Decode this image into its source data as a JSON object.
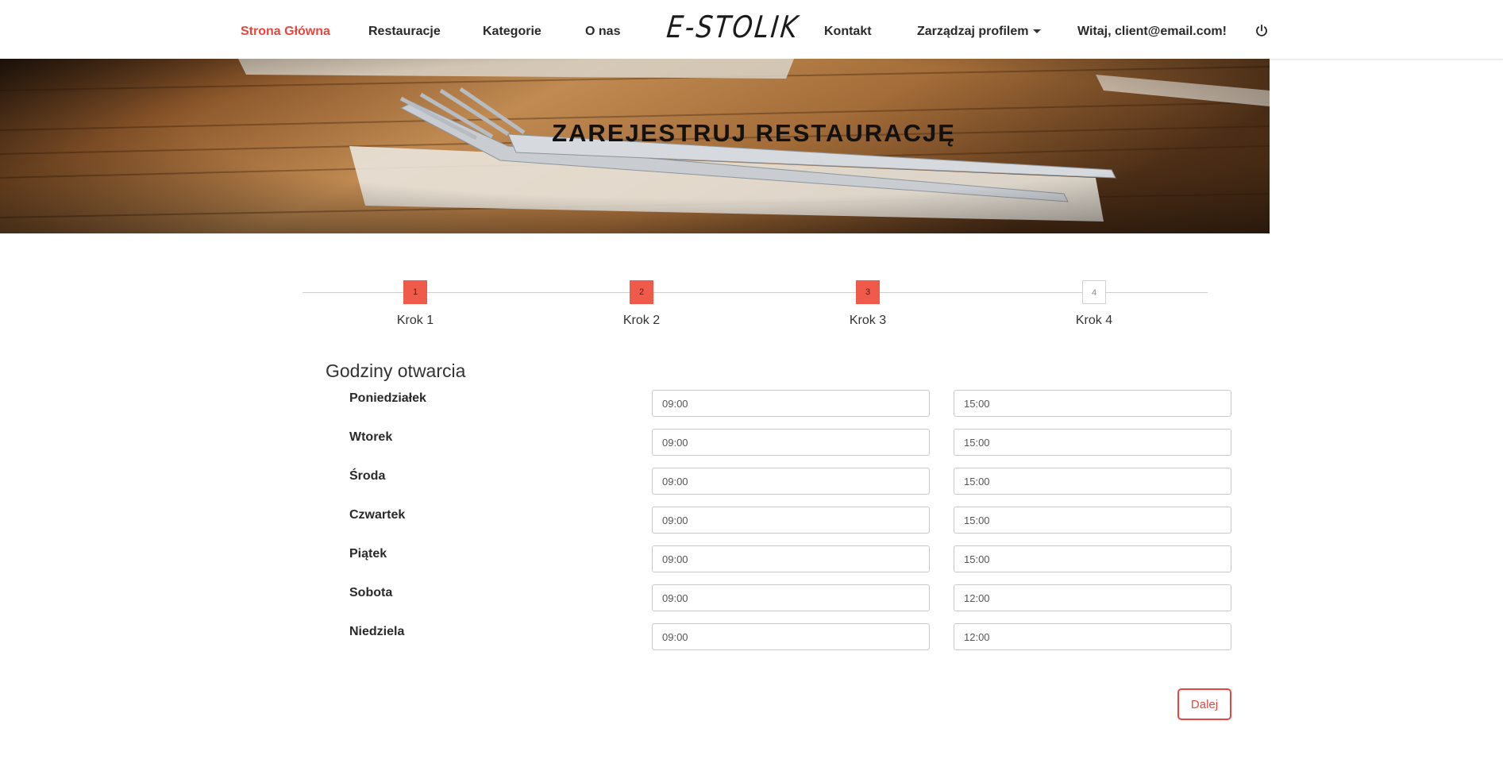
{
  "nav": {
    "items": [
      {
        "label": "Strona Główna"
      },
      {
        "label": "Restauracje"
      },
      {
        "label": "Kategorie"
      },
      {
        "label": "O nas"
      },
      {
        "label": "Kontakt"
      },
      {
        "label": "Zarządzaj profilem"
      },
      {
        "label": "Witaj, client@email.com!"
      }
    ],
    "logo": "E-STOLIK",
    "active_color": "#e8463d",
    "logout_icon": "power-icon"
  },
  "hero": {
    "title": "ZAREJESTRUJ RESTAURACJĘ"
  },
  "stepper": {
    "current_step": 3,
    "steps": [
      {
        "number": "1",
        "label": "Krok 1",
        "state": "done"
      },
      {
        "number": "2",
        "label": "Krok 2",
        "state": "done"
      },
      {
        "number": "3",
        "label": "Krok 3",
        "state": "done"
      },
      {
        "number": "4",
        "label": "Krok 4",
        "state": "todo"
      }
    ],
    "accent_color": "#f05a4b"
  },
  "form": {
    "section_title": "Godziny otwarcia",
    "days": [
      {
        "name": "Poniedziałek",
        "open": "09:00",
        "close": "15:00"
      },
      {
        "name": "Wtorek",
        "open": "09:00",
        "close": "15:00"
      },
      {
        "name": "Środa",
        "open": "09:00",
        "close": "15:00"
      },
      {
        "name": "Czwartek",
        "open": "09:00",
        "close": "15:00"
      },
      {
        "name": "Piątek",
        "open": "09:00",
        "close": "15:00"
      },
      {
        "name": "Sobota",
        "open": "09:00",
        "close": "12:00"
      },
      {
        "name": "Niedziela",
        "open": "09:00",
        "close": "12:00"
      }
    ],
    "next_label": "Dalej"
  }
}
